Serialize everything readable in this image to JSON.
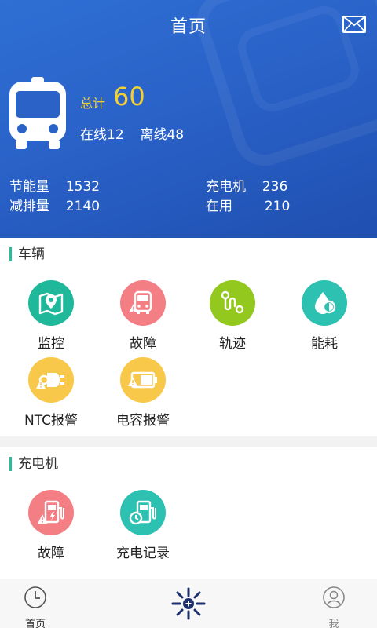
{
  "header": {
    "title": "首页",
    "total_label": "总计",
    "total_value": "60",
    "online_text": "在线12",
    "offline_text": "离线48",
    "stats": [
      {
        "label": "节能量",
        "value": "1532"
      },
      {
        "label": "减排量",
        "value": "2140"
      },
      {
        "label": "充电机",
        "value": "236"
      },
      {
        "label": "在用",
        "value": "210"
      }
    ]
  },
  "vehicle_section": {
    "title": "车辆",
    "items": [
      {
        "label": "监控",
        "icon": "map-icon",
        "color": "#20b89a"
      },
      {
        "label": "故障",
        "icon": "bus-warning-icon",
        "color": "#f37e83"
      },
      {
        "label": "轨迹",
        "icon": "route-icon",
        "color": "#93c81f"
      },
      {
        "label": "能耗",
        "icon": "energy-drop-icon",
        "color": "#2cc1b1"
      },
      {
        "label": "NTC报警",
        "icon": "plug-warning-icon",
        "color": "#f7c84a"
      },
      {
        "label": "电容报警",
        "icon": "battery-warning-icon",
        "color": "#f7c84a"
      }
    ]
  },
  "charger_section": {
    "title": "充电机",
    "items": [
      {
        "label": "故障",
        "icon": "charger-warning-icon",
        "color": "#f37e83"
      },
      {
        "label": "充电记录",
        "icon": "charger-record-icon",
        "color": "#2cc1b1"
      }
    ]
  },
  "tabbar": {
    "home_label": "首页",
    "me_label": "我"
  }
}
